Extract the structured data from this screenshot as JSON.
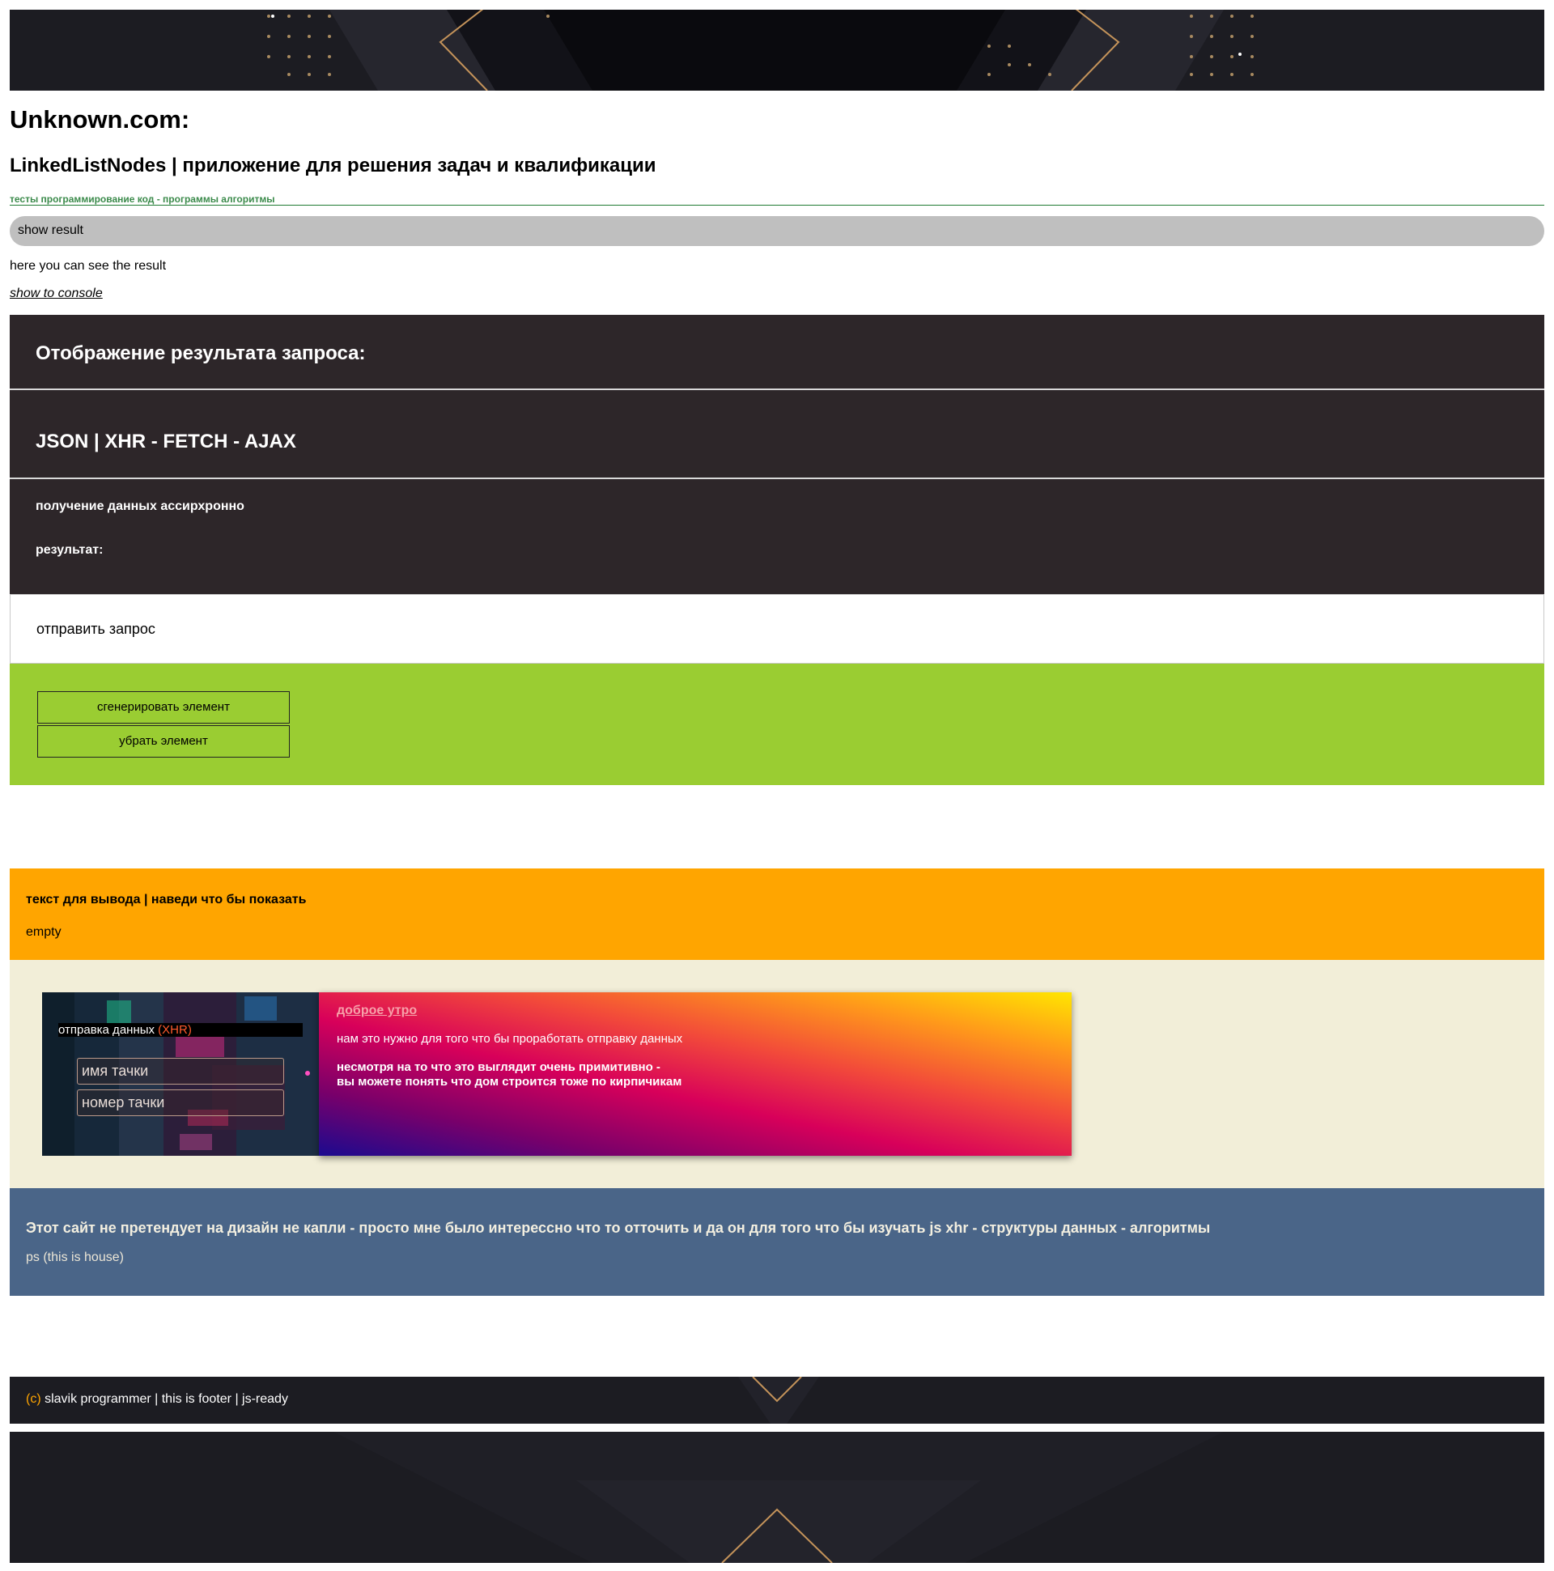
{
  "site": {
    "title": "Unknown.com:",
    "app_title": "LinkedListNodes | приложение для решения задач и квалификации",
    "tags": "тесты программирование код - программы алгоритмы"
  },
  "result": {
    "show_button": "show result",
    "text": "here you can see the result",
    "console_link": "show to console"
  },
  "request_panel": {
    "title": "Отображение результата запроса:",
    "subtitle": "JSON | XHR - FETCH - AJAX",
    "async_label": "получение данных ассирхронно",
    "result_label": "результат:",
    "send_button": "отправить запрос"
  },
  "generator": {
    "generate_button": "сгенерировать элемент",
    "remove_button": "убрать элемент"
  },
  "hover_box": {
    "title": "текст для вывода | наведи что бы показать",
    "value": "empty"
  },
  "form_card": {
    "label": "отправка данных ",
    "label_highlight": "(XHR)",
    "car_name_placeholder": "имя тачки",
    "car_number_placeholder": "номер тачки"
  },
  "info_card": {
    "link": "доброе утро",
    "paragraph1": "нам это нужно для того что бы проработать отправку данных",
    "paragraph2_line1": "несмотря на то что это выглядит очень примитивно -",
    "paragraph2_line2": "вы можете понять что дом строится тоже по кирпичикам"
  },
  "about": {
    "title": "Этот сайт не претендует на дизайн не капли - просто мне было интерессно что то отточить и да он для того что бы изучать js xhr - структуры данных - алгоритмы",
    "ps": "ps (this is house)"
  },
  "footer": {
    "copyright": "(c)",
    "text": " slavik programmer | this is footer | js-ready"
  },
  "colors": {
    "dark_panel": "#2d2629",
    "green": "#9acd32",
    "orange": "#ffa500",
    "beige": "#f2eed8",
    "blue": "#4a6588",
    "banner": "#1c1c22",
    "gold_accent": "#c4935a"
  }
}
